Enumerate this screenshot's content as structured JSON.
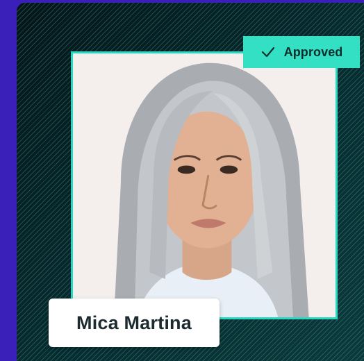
{
  "profile": {
    "name": "Mica Martina",
    "status": "Approved",
    "status_icon": "check-icon"
  },
  "colors": {
    "background": "#3a1fb8",
    "panel": "#062c30",
    "accent": "#34e0c4",
    "frame": "#27d9c0",
    "name_card": "#ffffff",
    "name_text": "#1b2b2f"
  }
}
